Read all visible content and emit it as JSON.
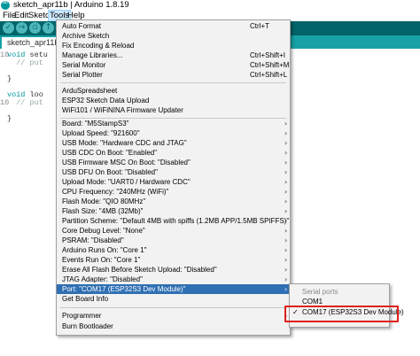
{
  "window": {
    "title": "sketch_apr11b | Arduino 1.8.19"
  },
  "menubar": {
    "items": [
      "File",
      "Edit",
      "Sketch",
      "Tools",
      "Help"
    ]
  },
  "toolbar": {
    "verify_icon": "check-icon",
    "upload_icon": "arrow-right-icon",
    "new_icon": "new-file-icon"
  },
  "tab": {
    "label": "sketch_apr11b"
  },
  "editor": {
    "line_numbers": [
      "10",
      "",
      "",
      "",
      "",
      "",
      "10",
      "",
      "",
      ""
    ],
    "lines": [
      {
        "kw": "void",
        "rest": " setu"
      },
      {
        "kw": "",
        "rest": "  // put"
      },
      {
        "kw": "",
        "rest": ""
      },
      {
        "kw": "",
        "rest": "}"
      },
      {
        "kw": "",
        "rest": ""
      },
      {
        "kw": "void",
        "rest": " loo"
      },
      {
        "kw": "",
        "rest": "  // put"
      },
      {
        "kw": "",
        "rest": ""
      },
      {
        "kw": "",
        "rest": "}"
      }
    ]
  },
  "tools_menu": {
    "group1": [
      {
        "label": "Auto Format",
        "shortcut": "Ctrl+T"
      },
      {
        "label": "Archive Sketch",
        "shortcut": ""
      },
      {
        "label": "Fix Encoding & Reload",
        "shortcut": ""
      },
      {
        "label": "Manage Libraries...",
        "shortcut": "Ctrl+Shift+I"
      },
      {
        "label": "Serial Monitor",
        "shortcut": "Ctrl+Shift+M"
      },
      {
        "label": "Serial Plotter",
        "shortcut": "Ctrl+Shift+L"
      }
    ],
    "group2": [
      {
        "label": "ArduSpreadsheet"
      },
      {
        "label": "ESP32 Sketch Data Upload"
      },
      {
        "label": "WiFi101 / WiFiNINA Firmware Updater"
      }
    ],
    "group3": [
      {
        "label": "Board: \"M5StampS3\""
      },
      {
        "label": "Upload Speed: \"921600\""
      },
      {
        "label": "USB Mode: \"Hardware CDC and JTAG\""
      },
      {
        "label": "USB CDC On Boot: \"Enabled\""
      },
      {
        "label": "USB Firmware MSC On Boot: \"Disabled\""
      },
      {
        "label": "USB DFU On Boot: \"Disabled\""
      },
      {
        "label": "Upload Mode: \"UART0 / Hardware CDC\""
      },
      {
        "label": "CPU Frequency: \"240MHz (WiFi)\""
      },
      {
        "label": "Flash Mode: \"QIO 80MHz\""
      },
      {
        "label": "Flash Size: \"4MB (32Mb)\""
      },
      {
        "label": "Partition Scheme: \"Default 4MB with spiffs (1.2MB APP/1.5MB SPIFFS)\""
      },
      {
        "label": "Core Debug Level: \"None\""
      },
      {
        "label": "PSRAM: \"Disabled\""
      },
      {
        "label": "Arduino Runs On: \"Core 1\""
      },
      {
        "label": "Events Run On: \"Core 1\""
      },
      {
        "label": "Erase All Flash Before Sketch Upload: \"Disabled\""
      },
      {
        "label": "JTAG Adapter: \"Disabled\""
      },
      {
        "label": "Port: \"COM17 (ESP32S3 Dev Module)\""
      },
      {
        "label": "Get Board Info"
      }
    ],
    "group4": [
      {
        "label": "Programmer"
      },
      {
        "label": "Burn Bootloader"
      }
    ]
  },
  "port_submenu": {
    "header": "Serial ports",
    "items": [
      {
        "label": "COM1",
        "checked": false
      },
      {
        "label": "COM17 (ESP32S3 Dev Module)",
        "checked": true
      }
    ],
    "check_glyph": "✓"
  },
  "colors": {
    "toolbar": "#006468",
    "tabstrip": "#17a1a5",
    "highlight": "#2f6fb3",
    "annotation": "#e0201b"
  }
}
